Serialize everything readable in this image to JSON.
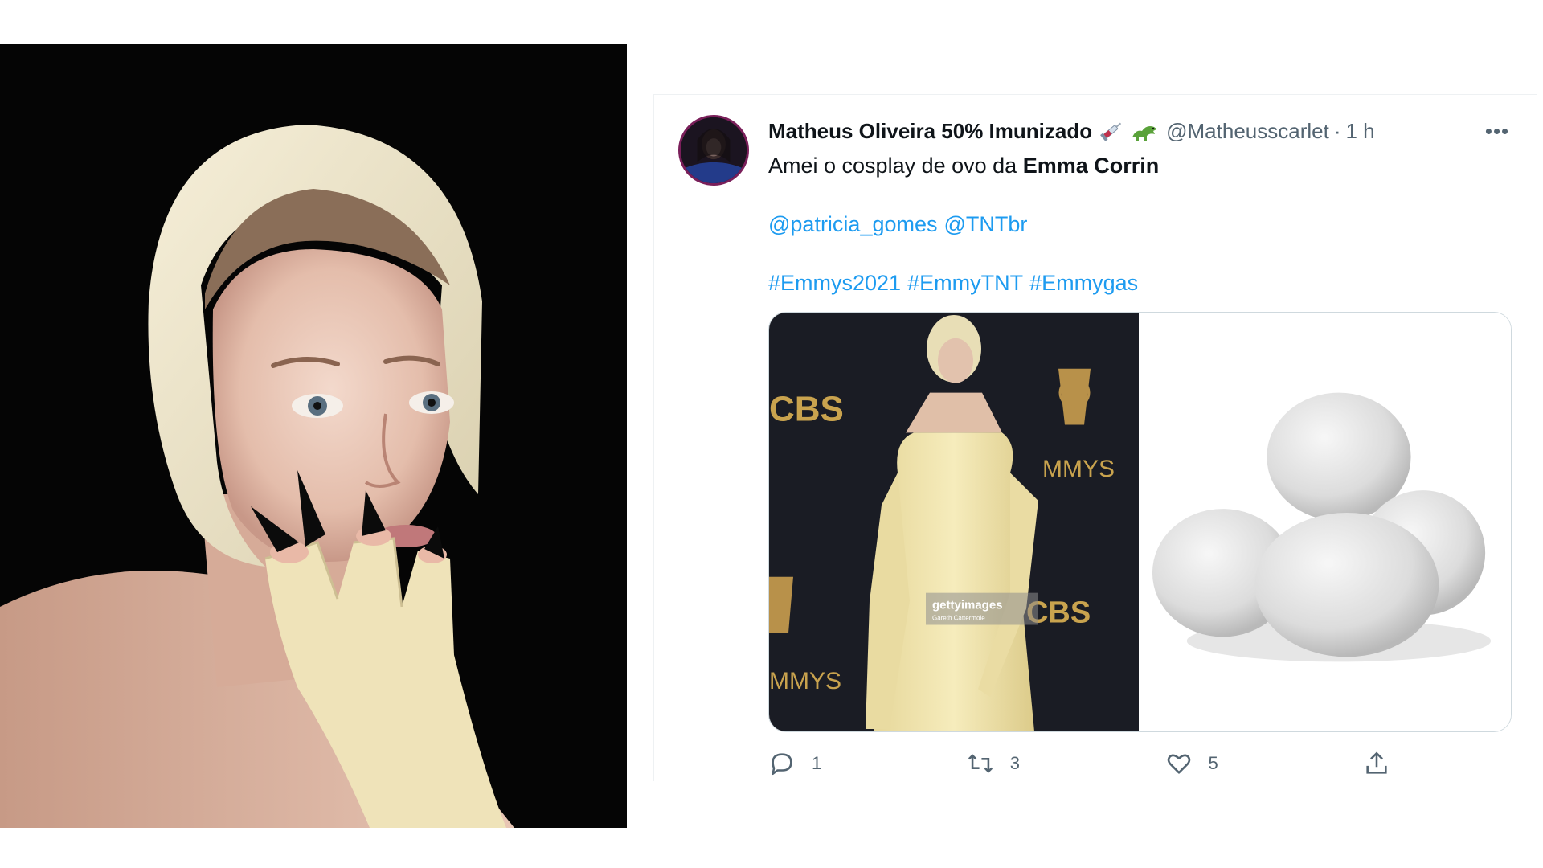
{
  "tweet": {
    "display_name": "Matheus Oliveira 50% Imunizado",
    "name_emojis": [
      "syringe-emoji",
      "dinosaur-emoji"
    ],
    "username": "@Matheusscarlet",
    "separator": "·",
    "timestamp": "1 h",
    "more_label": "•••",
    "text_prefix": "Amei o cosplay de ovo da ",
    "text_bold": "Emma Corrin",
    "mentions": [
      "@patricia_gomes",
      "@TNTbr"
    ],
    "hashtags": [
      "#Emmys2021",
      "#EmmyTNT",
      "#Emmygas"
    ],
    "media": {
      "left_logo_top": "CBS",
      "left_logo_bottom": "CBS",
      "emmys_text_top": "MMYS",
      "emmys_text_bottom": "MMYS",
      "watermark": "gettyimages",
      "watermark_credit": "Gareth Cattermole"
    },
    "actions": {
      "reply_count": "1",
      "retweet_count": "3",
      "like_count": "5"
    }
  },
  "colors": {
    "link": "#1d9bf0",
    "text": "#0f1419",
    "secondary": "#536471",
    "border": "#cfd9de"
  }
}
